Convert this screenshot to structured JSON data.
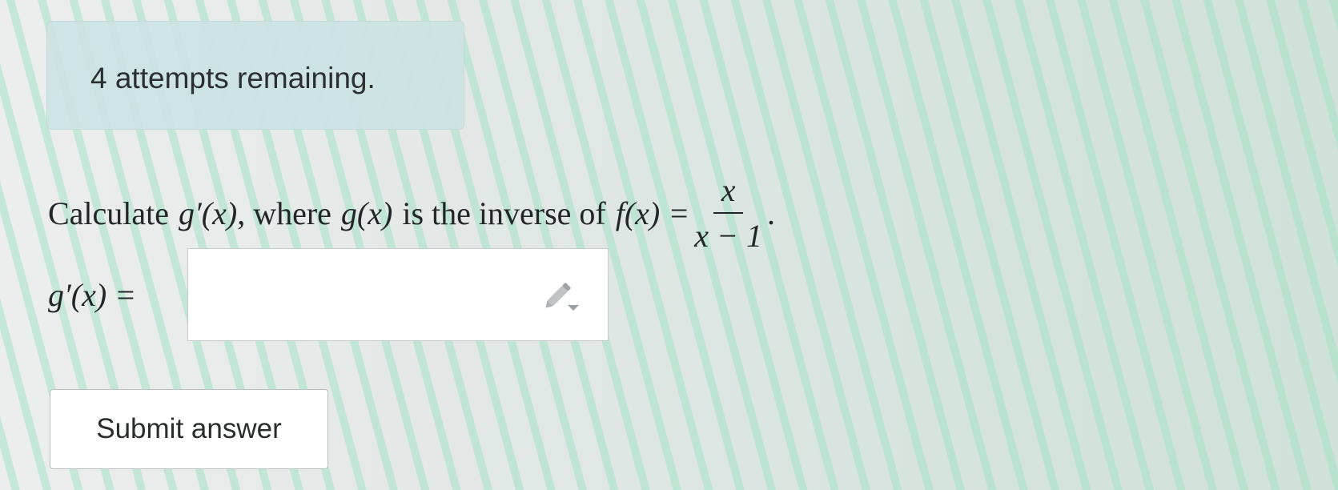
{
  "attempts": {
    "text": "4 attempts remaining."
  },
  "question": {
    "prefix": "Calculate",
    "gprime": "g′(x)",
    "middle": ", where",
    "g": "g(x)",
    "middle2": "is the inverse of",
    "f": "f(x) =",
    "numerator": "x",
    "denominator": "x − 1",
    "suffix": "."
  },
  "answer": {
    "label": "g′(x) =",
    "value": "",
    "icon": "pencil-dropdown-icon"
  },
  "submit": {
    "label": "Submit answer"
  },
  "colors": {
    "attempts_background": "#cce3e3",
    "stripe_green": "#a4e2c6",
    "text": "#232629"
  }
}
